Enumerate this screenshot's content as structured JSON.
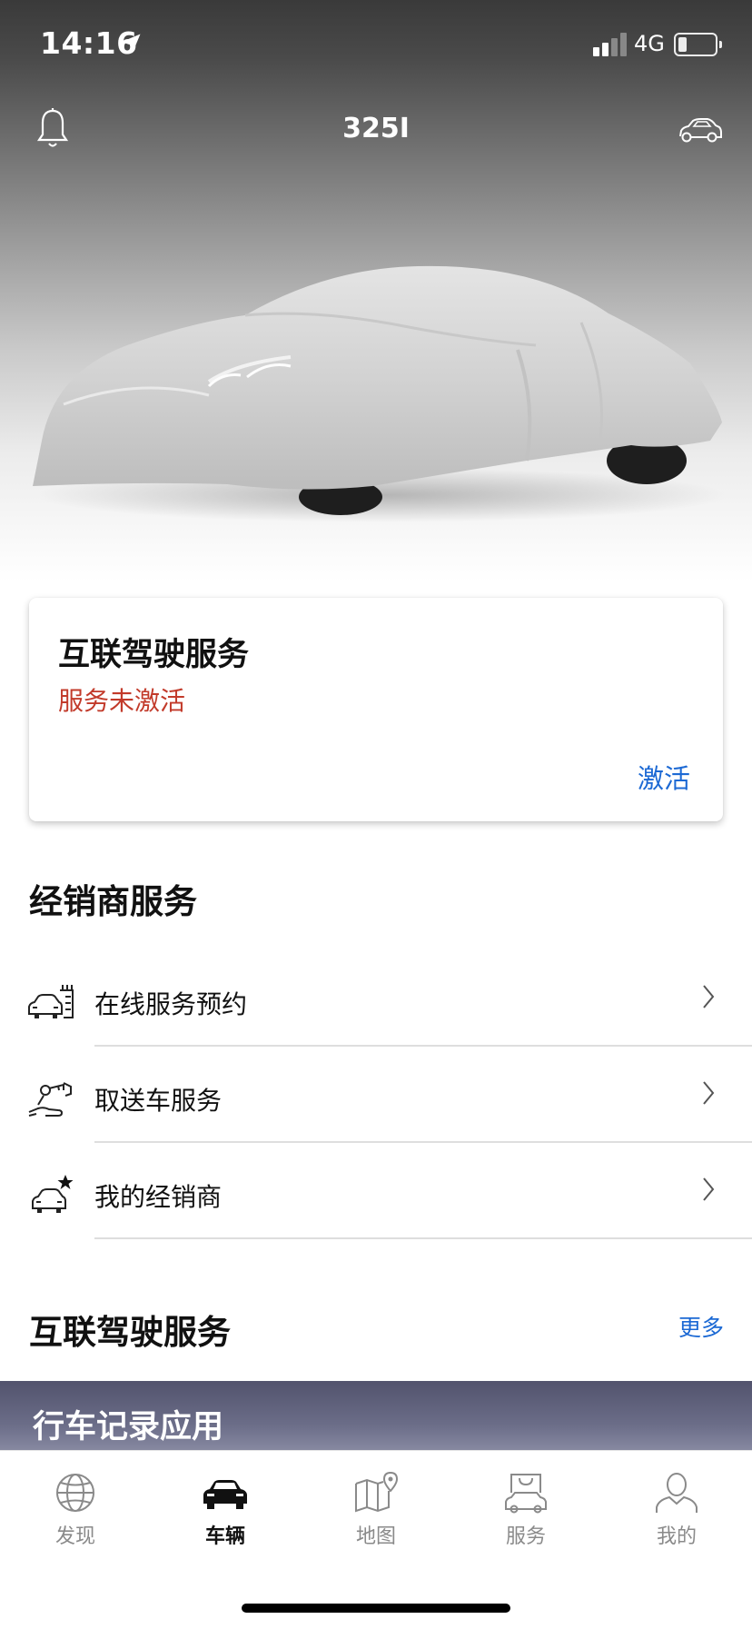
{
  "status_bar": {
    "time": "14:16",
    "network": "4G"
  },
  "header": {
    "title": "325I"
  },
  "activation_card": {
    "title": "互联驾驶服务",
    "status": "服务未激活",
    "action": "激活"
  },
  "dealer_services": {
    "title": "经销商服务",
    "items": [
      {
        "label": "在线服务预约",
        "icon": "service-appointment-icon"
      },
      {
        "label": "取送车服务",
        "icon": "key-handover-icon"
      },
      {
        "label": "我的经销商",
        "icon": "car-star-icon"
      }
    ]
  },
  "connected_drive": {
    "title": "互联驾驶服务",
    "more": "更多",
    "banner_title": "行车记录应用"
  },
  "tabs": [
    {
      "label": "发现",
      "icon": "globe-icon",
      "active": false
    },
    {
      "label": "车辆",
      "icon": "car-icon",
      "active": true
    },
    {
      "label": "地图",
      "icon": "map-icon",
      "active": false
    },
    {
      "label": "服务",
      "icon": "shopping-bag-car-icon",
      "active": false
    },
    {
      "label": "我的",
      "icon": "person-icon",
      "active": false
    }
  ],
  "colors": {
    "accent": "#1c69d4",
    "status_red": "#c23a2a"
  }
}
